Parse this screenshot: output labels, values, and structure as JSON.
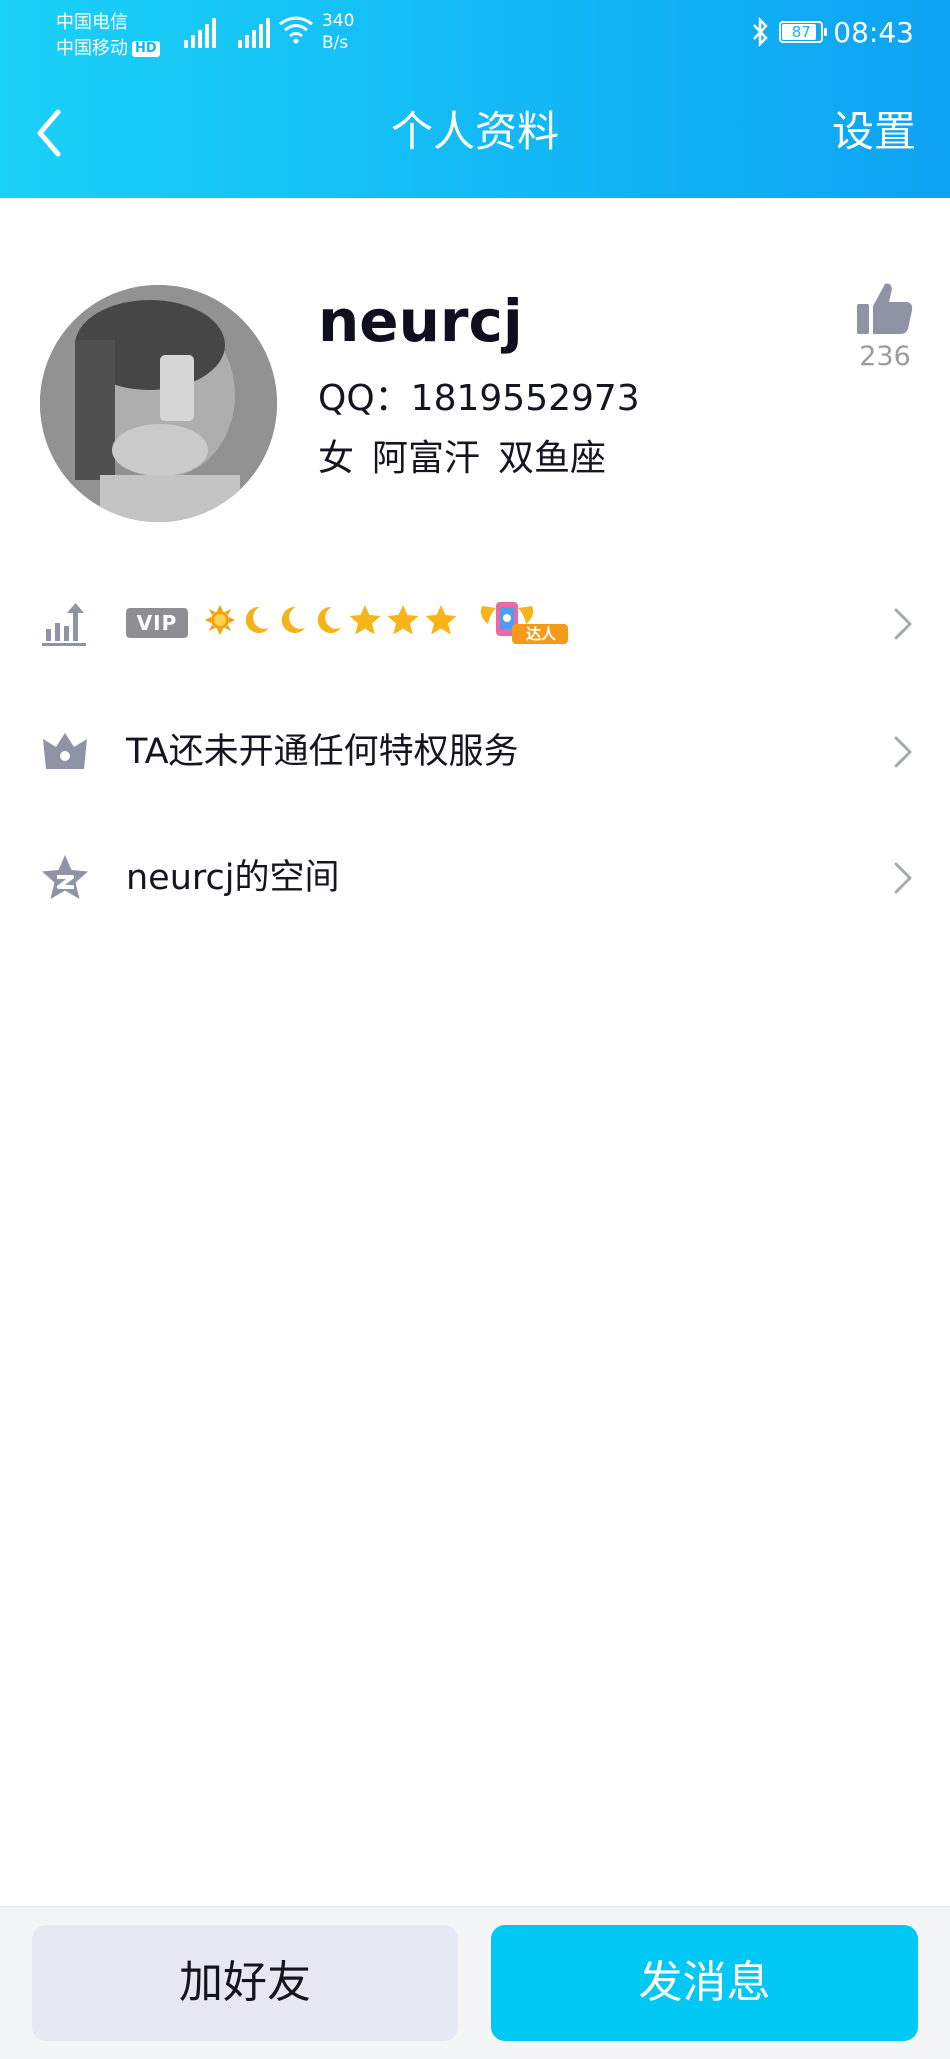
{
  "status_bar": {
    "carrier1": "中国电信",
    "carrier2": "中国移动",
    "hd_label": "HD",
    "net_speed_value": "340",
    "net_speed_unit": "B/s",
    "battery": "87",
    "time": "08:43"
  },
  "nav": {
    "back_icon": "chevron-left-icon",
    "title": "个人资料",
    "settings_label": "设置"
  },
  "profile": {
    "nickname": "neurcj",
    "qq_line": "QQ：1819552973",
    "gender": "女",
    "location": "阿富汗",
    "zodiac": "双鱼座",
    "like_count": "236",
    "like_icon": "thumbs-up-icon"
  },
  "rows": {
    "level": {
      "icon": "level-chart-icon",
      "vip_label": "VIP",
      "level_icons": [
        "sun-icon",
        "moon-icon",
        "moon-icon",
        "moon-icon",
        "star-icon",
        "star-icon",
        "star-icon"
      ],
      "talent_label": "达人"
    },
    "privilege": {
      "icon": "crown-icon",
      "label": "TA还未开通任何特权服务"
    },
    "space": {
      "icon": "qzone-star-icon",
      "label": "neurcj的空间"
    }
  },
  "bottom": {
    "add_friend": "加好友",
    "send_message": "发消息"
  },
  "colors": {
    "header_start": "#1ad1f7",
    "header_end": "#0ea3f3",
    "primary_button": "#00c8f5",
    "secondary_button": "#e6e9f4",
    "icon_gray": "#8e93a6"
  }
}
